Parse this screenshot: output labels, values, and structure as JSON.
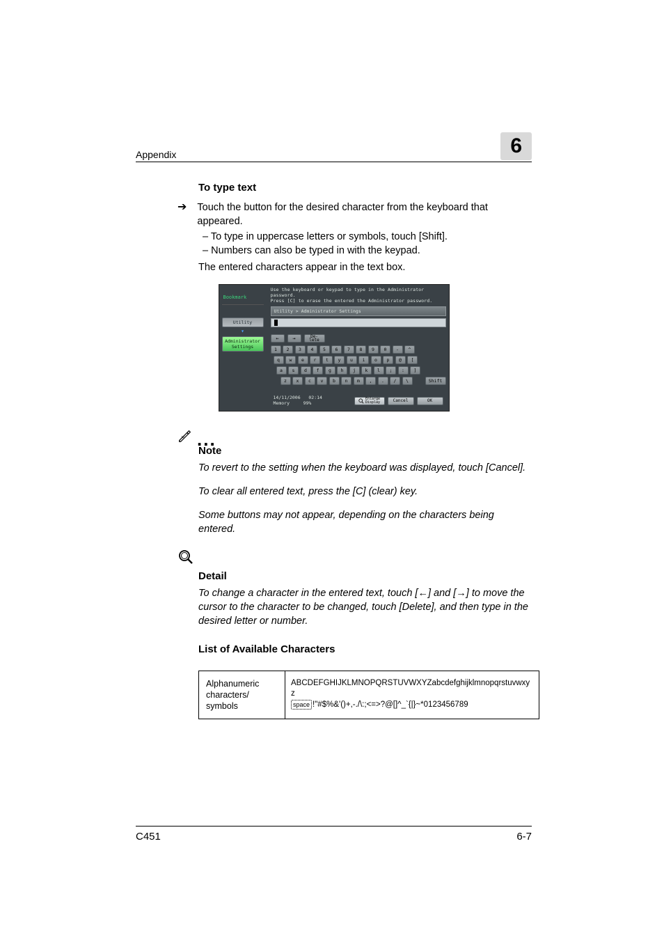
{
  "header": {
    "section_label": "Appendix",
    "chapter_number": "6"
  },
  "s1": {
    "heading": "To type text",
    "step1": "Touch the button for the desired character from the keyboard that appeared.",
    "dash1": "To type in uppercase letters or symbols, touch [Shift].",
    "dash2": "Numbers can also be typed in with the keypad.",
    "line2": "The entered characters appear in the text box."
  },
  "shot": {
    "bookmark_label": "Bookmark",
    "nav1": "Utility",
    "nav2_a": "Administrator",
    "nav2_b": "Settings",
    "msg_line1": "Use the keyboard or keypad to type in the Administrator password.",
    "msg_line2": "Press [C] to erase the entered the Administrator password.",
    "breadcrumb": "Utility > Administrator Settings",
    "delete_label": "De-\nlete",
    "row1": [
      "1",
      "2",
      "3",
      "4",
      "5",
      "6",
      "7",
      "8",
      "9",
      "0",
      "-",
      "^"
    ],
    "row2": [
      "q",
      "w",
      "e",
      "r",
      "t",
      "y",
      "u",
      "i",
      "o",
      "p",
      "@",
      "["
    ],
    "row3": [
      "a",
      "s",
      "d",
      "f",
      "g",
      "h",
      "j",
      "k",
      "l",
      ";",
      ":",
      "]"
    ],
    "row4": [
      "z",
      "x",
      "c",
      "v",
      "b",
      "n",
      "m",
      ",",
      ".",
      "/",
      "\\"
    ],
    "shift_label": "Shift",
    "arrow_left": "←",
    "arrow_right": "→",
    "date": "14/11/2006",
    "time": "02:14",
    "mem_label": "Memory",
    "mem_pct": "99%",
    "enlarge_label": "Enlarge\nDisplay",
    "cancel_label": "Cancel",
    "ok_label": "OK"
  },
  "note": {
    "title": "Note",
    "p1": "To revert to the setting when the keyboard was displayed, touch [Cancel].",
    "p2": "To clear all entered text, press the [C] (clear) key.",
    "p3": "Some buttons may not appear, depending on the characters being entered."
  },
  "detail": {
    "title": "Detail",
    "p_a": "To change a character in the entered text, touch [",
    "arrow_l": "←",
    "p_b": "] and [",
    "arrow_r": "→",
    "p_c": "] to move the cursor to the character to be changed, touch [Delete], and then type in the desired letter or number."
  },
  "chars": {
    "heading": "List of Available Characters",
    "col1_a": "Alphanumeric",
    "col1_b": "characters/",
    "col1_c": "symbols",
    "line1": "ABCDEFGHIJKLMNOPQRSTUVWXYZabcdefghijklmnopqrstuvwxyz",
    "space_label": "space",
    "line2": "!\"#$%&'()+,-./\\:;<=>?@[]^_`{|}~*0123456789"
  },
  "footer": {
    "model": "C451",
    "page": "6-7"
  }
}
